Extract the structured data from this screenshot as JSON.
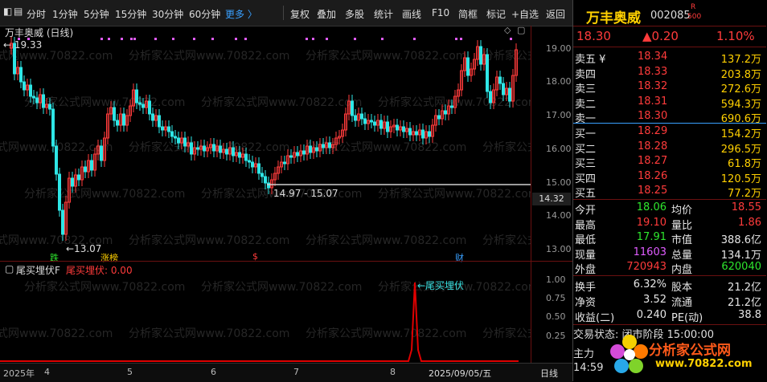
{
  "toolbar": {
    "items": [
      "分时",
      "1分钟",
      "5分钟",
      "15分钟",
      "30分钟",
      "60分钟",
      "更多 〉",
      "复权",
      "叠加",
      "多股",
      "统计",
      "画线",
      "F10",
      "简框",
      "标记",
      "+自选",
      "返回"
    ]
  },
  "main_chart": {
    "title": "万丰奥威 (日线)",
    "high_label": "19.33",
    "low_label": "←13.07",
    "range_label": "14.97 - 15.07",
    "current_price_tag": "14.32",
    "y_ticks": [
      "19.00",
      "18.00",
      "17.00",
      "16.00",
      "15.00",
      "14.00",
      "13.00"
    ],
    "markers": {
      "die": "跌",
      "zhangting": "涨榜",
      "dollar": "$",
      "cai": "财"
    },
    "watermark": "分析家公式网www.70822.com"
  },
  "indicator": {
    "name": "尾买埋伏F",
    "value_label": "尾买埋伏: 0.00",
    "signal_label": "←尾买埋伏",
    "y_ticks": [
      "1.00",
      "0.75",
      "0.50",
      "0.25"
    ]
  },
  "bottom_bar": {
    "labels": [
      "2025年",
      "4",
      "5",
      "6",
      "7",
      "8",
      "2025/09/05/五"
    ],
    "period": "日线"
  },
  "quote": {
    "name": "万丰奥威",
    "code": "002085",
    "badge_top": "R",
    "badge_bottom": "500",
    "price": "18.30",
    "change": "▲0.20",
    "change_pct": "1.10%",
    "asks": [
      {
        "label": "卖五 ¥",
        "price": "18.34",
        "vol": "137.2万"
      },
      {
        "label": "卖四",
        "price": "18.33",
        "vol": "203.8万"
      },
      {
        "label": "卖三",
        "price": "18.32",
        "vol": "272.6万"
      },
      {
        "label": "卖二",
        "price": "18.31",
        "vol": "594.3万"
      },
      {
        "label": "卖一",
        "price": "18.30",
        "vol": "690.6万"
      }
    ],
    "bids": [
      {
        "label": "买一",
        "price": "18.29",
        "vol": "154.2万"
      },
      {
        "label": "买二",
        "price": "18.28",
        "vol": "296.5万"
      },
      {
        "label": "买三",
        "price": "18.27",
        "vol": "61.8万"
      },
      {
        "label": "买四",
        "price": "18.26",
        "vol": "120.5万"
      },
      {
        "label": "买五",
        "price": "18.25",
        "vol": "77.2万"
      }
    ],
    "stats": [
      {
        "l1": "今开",
        "v1": "18.06",
        "l2": "均价",
        "v2": "18.55"
      },
      {
        "l1": "最高",
        "v1": "19.10",
        "l2": "量比",
        "v2": "1.86"
      },
      {
        "l1": "最低",
        "v1": "17.91",
        "l2": "市值",
        "v2": "388.6亿"
      },
      {
        "l1": "现量",
        "v1": "11603",
        "l2": "总量",
        "v2": "134.1万"
      },
      {
        "l1": "外盘",
        "v1": "720943",
        "l2": "内盘",
        "v2": "620040"
      }
    ],
    "stats2": [
      {
        "l1": "换手",
        "v1": "6.32%",
        "l2": "股本",
        "v2": "21.2亿"
      },
      {
        "l1": "净资",
        "v1": "3.52",
        "l2": "流通",
        "v2": "21.2亿"
      },
      {
        "l1": "收益(二)",
        "v1": "0.240",
        "l2": "PE(动)",
        "v2": "38.8"
      }
    ],
    "status": "交易状态: 闭市阶段 15:00:00",
    "zhuli": "主力",
    "time": "14:59",
    "logo_text": "分析家公式网",
    "logo_url": "www.70822.com"
  },
  "colors": {
    "up": "#ff3b3b",
    "down": "#2ee6e6",
    "accent": "#39a0ff",
    "signal": "#e00000"
  }
}
